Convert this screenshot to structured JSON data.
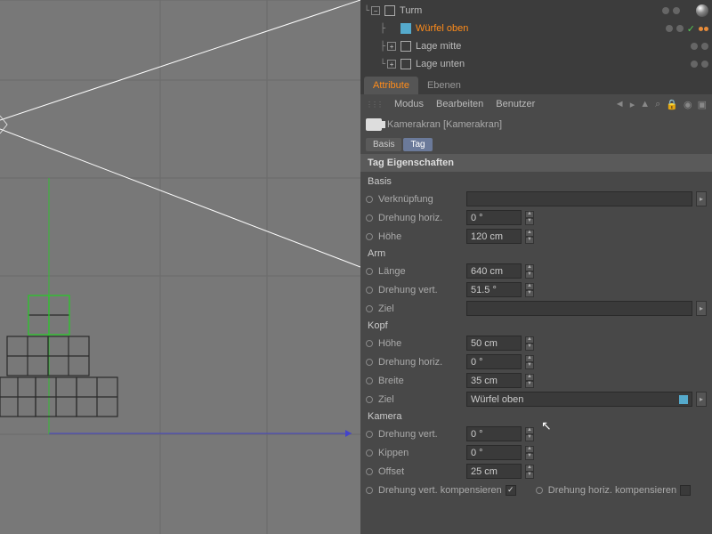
{
  "hierarchy": {
    "items": [
      {
        "label": "Turm",
        "indent": 0,
        "expand": "-",
        "icon": "null",
        "selected": false
      },
      {
        "label": "Würfel oben",
        "indent": 1,
        "expand": "",
        "icon": "cube",
        "selected": true,
        "tags": [
          "check",
          "dots"
        ]
      },
      {
        "label": "Lage mitte",
        "indent": 1,
        "expand": "+",
        "icon": "null",
        "selected": false
      },
      {
        "label": "Lage unten",
        "indent": 1,
        "expand": "+",
        "icon": "null",
        "selected": false
      }
    ]
  },
  "tabs": {
    "attribute": "Attribute",
    "ebenen": "Ebenen"
  },
  "menubar": {
    "modus": "Modus",
    "bearbeiten": "Bearbeiten",
    "benutzer": "Benutzer"
  },
  "object_header": "Kamerakran [Kamerakran]",
  "mode_tabs": {
    "basis": "Basis",
    "tag": "Tag"
  },
  "section_title": "Tag Eigenschaften",
  "groups": {
    "basis": {
      "title": "Basis",
      "verknuepfung": {
        "label": "Verknüpfung",
        "value": ""
      },
      "drehung_horiz": {
        "label": "Drehung horiz.",
        "value": "0 °"
      },
      "hoehe": {
        "label": "Höhe",
        "value": "120 cm"
      }
    },
    "arm": {
      "title": "Arm",
      "laenge": {
        "label": "Länge",
        "value": "640 cm"
      },
      "drehung_vert": {
        "label": "Drehung vert.",
        "value": "51.5 °"
      },
      "ziel": {
        "label": "Ziel",
        "value": ""
      }
    },
    "kopf": {
      "title": "Kopf",
      "hoehe": {
        "label": "Höhe",
        "value": "50 cm"
      },
      "drehung_horiz": {
        "label": "Drehung horiz.",
        "value": "0 °"
      },
      "breite": {
        "label": "Breite",
        "value": "35 cm"
      },
      "ziel": {
        "label": "Ziel",
        "value": "Würfel oben"
      }
    },
    "kamera": {
      "title": "Kamera",
      "drehung_vert": {
        "label": "Drehung vert.",
        "value": "0 °"
      },
      "kippen": {
        "label": "Kippen",
        "value": "0 °"
      },
      "offset": {
        "label": "Offset",
        "value": "25 cm"
      },
      "komp_vert": {
        "label": "Drehung vert. kompensieren",
        "checked": true
      },
      "komp_horiz": {
        "label": "Drehung horiz. kompensieren",
        "checked": false
      }
    }
  }
}
